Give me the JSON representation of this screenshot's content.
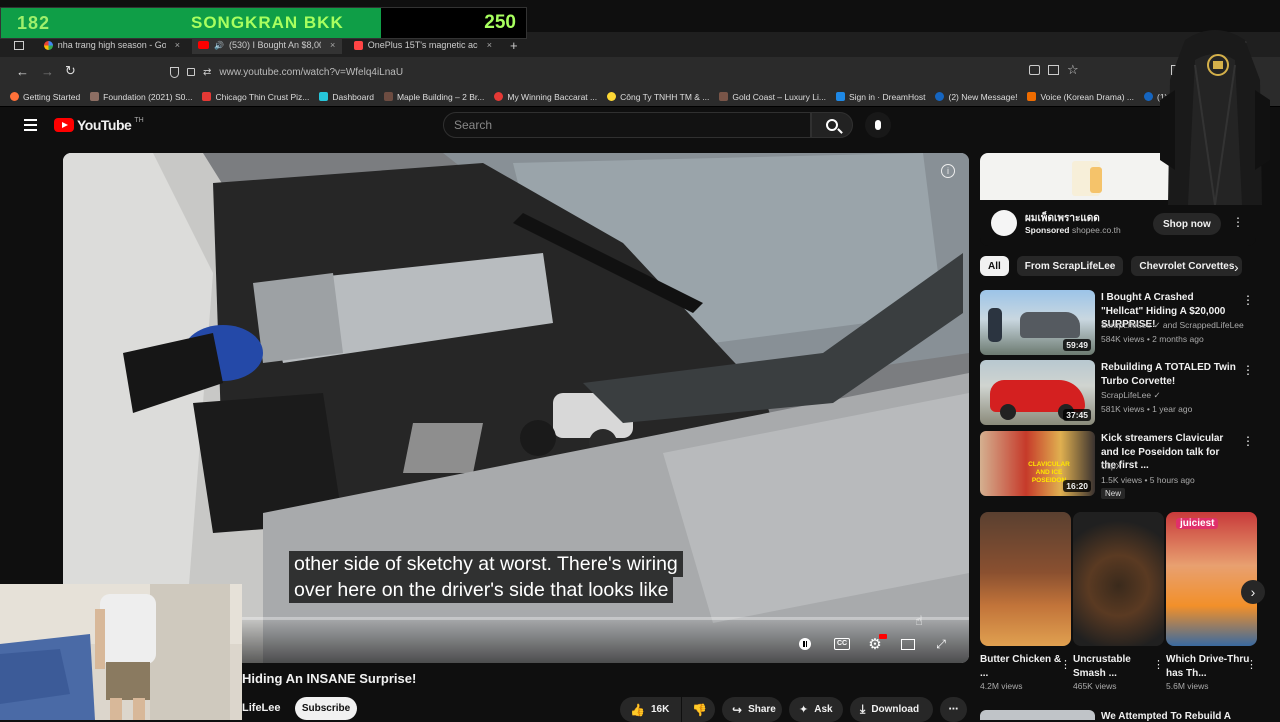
{
  "overlay": {
    "left_number": "182",
    "title": "SONGKRAN BKK",
    "right_number": "250"
  },
  "tabs": [
    {
      "label": "nha trang high season - Googl",
      "close": "×"
    },
    {
      "label": "(530) I Bought An $8,000 C",
      "close": "×"
    },
    {
      "label": "OnePlus 15T's magnetic access",
      "close": "×"
    }
  ],
  "new_tab": "+",
  "url": "www.youtube.com/watch?v=Wfelq4iLnaU",
  "bookmarks": [
    {
      "label": "Getting Started",
      "color": "#ff7139"
    },
    {
      "label": "Foundation (2021) S0...",
      "color": "#8d6e63"
    },
    {
      "label": "Chicago Thin Crust Piz...",
      "color": "#e53935"
    },
    {
      "label": "Dashboard",
      "color": "#26c6da"
    },
    {
      "label": "Maple Building – 2 Br...",
      "color": "#6d4c41"
    },
    {
      "label": "My Winning Baccarat ...",
      "color": "#e53935"
    },
    {
      "label": "Công Ty TNHH TM & ...",
      "color": "#fdd835"
    },
    {
      "label": "Gold Coast – Luxury Li...",
      "color": "#795548"
    },
    {
      "label": "Sign in · DreamHost",
      "color": "#1e88e5"
    },
    {
      "label": "(2) New Message!",
      "color": "#1565c0"
    },
    {
      "label": "Voice (Korean Drama) ...",
      "color": "#ef6c00"
    },
    {
      "label": "(1) New Me",
      "color": "#1565c0"
    }
  ],
  "yt": {
    "logo": "YouTube",
    "logo_sup": "TH",
    "search_placeholder": "Search"
  },
  "video": {
    "subtitle_line1": "other side of sketchy at worst. There's wiring",
    "subtitle_line2": "over here on the driver's side that looks like",
    "title": "Hiding An INSANE Surprise!",
    "channel": "LifeLee",
    "subscribe": "Subscribe",
    "likes": "16K",
    "share": "Share",
    "ask": "Ask",
    "download": "Download"
  },
  "ad": {
    "advertiser": "ผมเพ็ดเพราะแดด",
    "sponsored": "Sponsored",
    "domain": "shopee.co.th",
    "cta": "Shop now"
  },
  "chips": [
    "All",
    "From ScrapLifeLee",
    "Chevrolet Corvettes"
  ],
  "recommendations": [
    {
      "title": "I Bought A Crashed \"Hellcat\" Hiding A $20,000 SURPRISE!",
      "channel": "ScrapLifeLee ✓ and ScrappedLifeLee",
      "meta": "584K views • 2 months ago",
      "duration": "59:49"
    },
    {
      "title": "Rebuilding A TOTALED Twin Turbo Corvette!",
      "channel": "ScrapLifeLee ✓",
      "meta": "581K views • 1 year ago",
      "duration": "37:45"
    },
    {
      "title": "Kick streamers Clavicular and Ice Poseidon talk for the first ...",
      "channel": "ClipX",
      "meta": "1.5K views • 5 hours ago",
      "duration": "16:20",
      "badge": "New"
    }
  ],
  "shorts": [
    {
      "title": "Butter Chicken & ...",
      "views": "4.2M views"
    },
    {
      "title": "Uncrustable Smash ...",
      "views": "465K views"
    },
    {
      "title": "Which Drive-Thru has Th...",
      "views": "5.6M views"
    }
  ],
  "shorts_overlay_text": "juiciest",
  "next_rec_title": "We Attempted To Rebuild A"
}
